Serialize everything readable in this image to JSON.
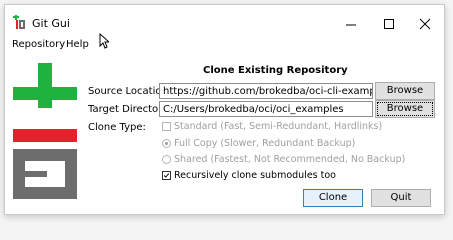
{
  "window": {
    "title": "Git Gui"
  },
  "menubar": {
    "items": [
      "Repository",
      "Help"
    ]
  },
  "dialog": {
    "heading": "Clone Existing Repository",
    "source_label": "Source Location:",
    "source_value": "https://github.com/brokedba/oci-cli-examples",
    "target_label": "Target Directory:",
    "target_value": "C:/Users/brokedba/oci/oci_examples",
    "browse_label": "Browse",
    "clone_type_label": "Clone Type:",
    "options": [
      {
        "label": "Standard (Fast, Semi-Redundant, Hardlinks)",
        "selected": false,
        "enabled": false
      },
      {
        "label": "Full Copy (Slower, Redundant Backup)",
        "selected": true,
        "enabled": false
      },
      {
        "label": "Shared (Fastest, Not Recommended, No Backup)",
        "selected": false,
        "enabled": false
      }
    ],
    "submodules_label": "Recursively clone submodules too",
    "submodules_checked": true,
    "clone_button": "Clone",
    "quit_button": "Quit"
  },
  "colors": {
    "logo_green": "#20b23f",
    "logo_red": "#e3222c",
    "logo_grey": "#6d6d6d"
  }
}
